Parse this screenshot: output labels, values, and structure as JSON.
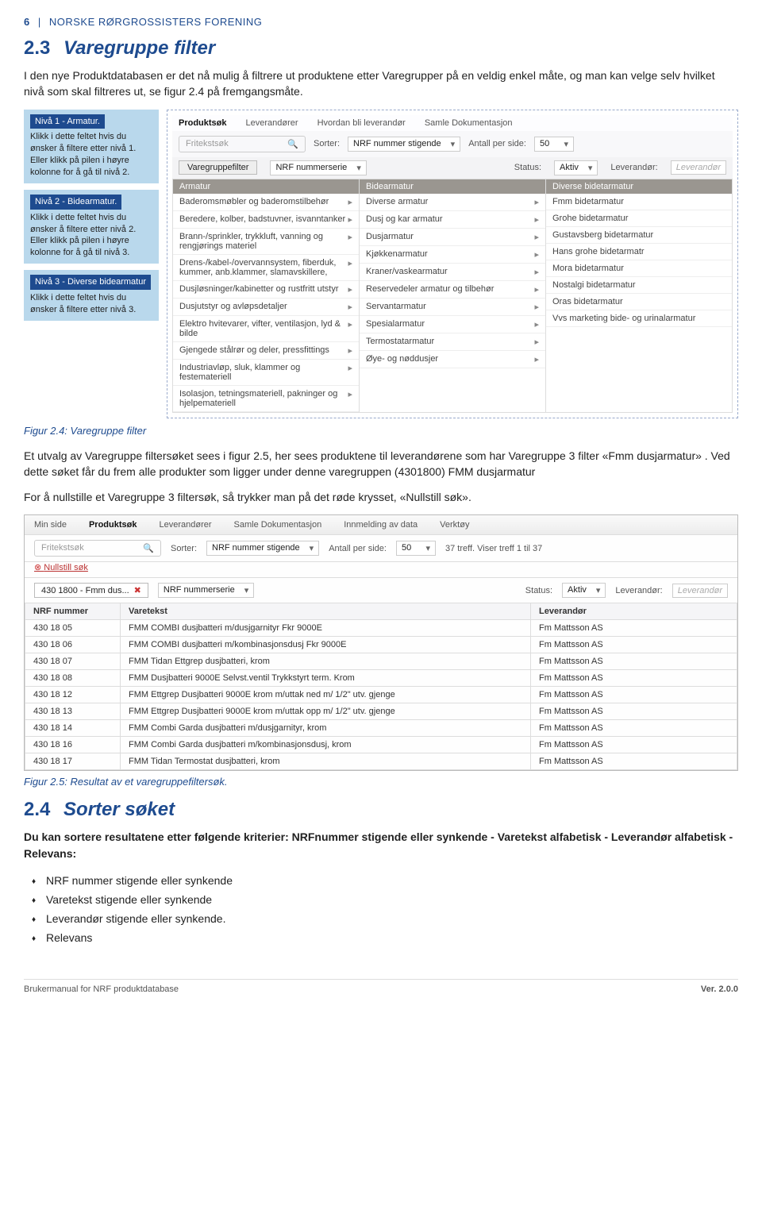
{
  "header": {
    "page": "6",
    "org": "NORSKE RØRGROSSISTERS FORENING"
  },
  "sec23": {
    "num": "2.3",
    "title": "Varegruppe filter",
    "intro": "I den nye Produktdatabasen er det nå mulig å filtrere ut produktene etter Varegrupper på en veldig enkel måte, og man kan velge selv hvilket nivå som skal filtreres ut, se figur 2.4 på fremgangsmåte."
  },
  "notes": [
    {
      "title": "Nivå 1 - Armatur.",
      "text": "Klikk i dette feltet hvis du ønsker å filtere etter nivå 1. Eller klikk på pilen i høyre kolonne for å gå til nivå 2."
    },
    {
      "title": "Nivå 2 - Bidearmatur.",
      "text": "Klikk i dette feltet hvis du ønsker å filtere etter nivå 2. Eller klikk på pilen i høyre kolonne for å gå til nivå 3."
    },
    {
      "title": "Nivå 3 - Diverse bidearmatur",
      "text": "Klikk i dette feltet hvis du ønsker å filtere etter nivå 3."
    }
  ],
  "app1": {
    "nav": [
      "Produktsøk",
      "Leverandører",
      "Hvordan bli leverandør",
      "Samle Dokumentasjon"
    ],
    "search_ph": "Fritekstsøk",
    "sort_lbl": "Sorter:",
    "sort_val": "NRF nummer stigende",
    "perpage_lbl": "Antall per side:",
    "perpage_val": "50",
    "vg_btn": "Varegruppefilter",
    "serie_lbl": "NRF nummerserie",
    "status_lbl": "Status:",
    "status_val": "Aktiv",
    "lev_lbl": "Leverandør:",
    "lev_ph": "Leverandør",
    "col1_hdr": "Armatur",
    "col2_hdr": "Bidearmatur",
    "col3_hdr": "Diverse bidetarmatur",
    "col1": [
      "Baderomsmøbler og baderomstilbehør",
      "Beredere, kolber, badstuvner, isvanntanker",
      "Brann-/sprinkler, trykkluft, vanning og rengjørings materiel",
      "Drens-/kabel-/overvannsystem, fiberduk, kummer, anb.klammer, slamavskillere,",
      "Dusjløsninger/kabinetter og rustfritt utstyr",
      "Dusjutstyr og avløpsdetaljer",
      "Elektro hvitevarer, vifter, ventilasjon, lyd & bilde",
      "Gjengede stålrør og deler, pressfittings",
      "Industriavløp, sluk, klammer og festemateriell",
      "Isolasjon, tetningsmateriell, pakninger og hjelpemateriell"
    ],
    "col2": [
      "Diverse armatur",
      "Dusj og kar armatur",
      "Dusjarmatur",
      "Kjøkkenarmatur",
      "Kraner/vaskearmatur",
      "Reservedeler armatur og tilbehør",
      "Servantarmatur",
      "Spesialarmatur",
      "Termostatarmatur",
      "Øye- og nøddusjer"
    ],
    "col3": [
      "Fmm bidetarmatur",
      "Grohe bidetarmatur",
      "Gustavsberg bidetarmatur",
      "Hans grohe bidetarmatr",
      "Mora bidetarmatur",
      "Nostalgi bidetarmatur",
      "Oras bidetarmatur",
      "Vvs marketing bide- og urinalarmatur"
    ]
  },
  "caption24": "Figur 2.4: Varegruppe filter",
  "mid1": "Et utvalg av Varegruppe filtersøket sees i figur 2.5, her sees produktene til leverandørene som har Varegruppe 3 filter «Fmm dusjarmatur» . Ved dette søket får du frem alle produkter som ligger under denne varegruppen (4301800) FMM dusjarmatur",
  "mid2": "For å nullstille et Varegruppe 3 filtersøk, så trykker man på det røde krysset, «Nullstill søk».",
  "app2": {
    "nav": [
      "Min side",
      "Produktsøk",
      "Leverandører",
      "Samle Dokumentasjon",
      "Innmelding av data",
      "Verktøy"
    ],
    "search_ph": "Fritekstsøk",
    "sort_lbl": "Sorter:",
    "sort_val": "NRF nummer stigende",
    "perpage_lbl": "Antall per side:",
    "perpage_val": "50",
    "count_txt": "37 treff. Viser treff 1 til 37",
    "reset": "Nullstill søk",
    "chip": "430 1800 - Fmm dus...",
    "serie_lbl": "NRF nummerserie",
    "status_lbl": "Status:",
    "status_val": "Aktiv",
    "lev_lbl": "Leverandør:",
    "lev_ph": "Leverandør",
    "th": [
      "NRF nummer",
      "Varetekst",
      "Leverandør"
    ],
    "rows": [
      [
        "430 18 05",
        "FMM COMBI dusjbatteri m/dusjgarnityr Fkr 9000E",
        "Fm Mattsson AS"
      ],
      [
        "430 18 06",
        "FMM COMBI dusjbatteri m/kombinasjonsdusj Fkr 9000E",
        "Fm Mattsson AS"
      ],
      [
        "430 18 07",
        "FMM Tidan Ettgrep dusjbatteri, krom",
        "Fm Mattsson AS"
      ],
      [
        "430 18 08",
        "FMM Dusjbatteri 9000E Selvst.ventil Trykkstyrt term. Krom",
        "Fm Mattsson AS"
      ],
      [
        "430 18 12",
        "FMM Ettgrep Dusjbatteri 9000E krom m/uttak ned m/ 1/2\" utv. gjenge",
        "Fm Mattsson AS"
      ],
      [
        "430 18 13",
        "FMM Ettgrep Dusjbatteri 9000E krom m/uttak opp m/ 1/2\" utv. gjenge",
        "Fm Mattsson AS"
      ],
      [
        "430 18 14",
        "FMM Combi Garda dusjbatteri m/dusjgarnityr, krom",
        "Fm Mattsson AS"
      ],
      [
        "430 18 16",
        "FMM Combi Garda dusjbatteri m/kombinasjonsdusj, krom",
        "Fm Mattsson AS"
      ],
      [
        "430 18 17",
        "FMM Tidan Termostat dusjbatteri, krom",
        "Fm Mattsson AS"
      ]
    ]
  },
  "caption25": "Figur 2.5: Resultat av et varegruppefiltersøk.",
  "sec24": {
    "num": "2.4",
    "title": "Sorter søket",
    "intro": "Du kan sortere resultatene etter følgende kriterier: NRFnummer stigende eller synkende - Varetekst alfabetisk - Leverandør alfabetisk - Relevans:",
    "bullets": [
      "NRF nummer stigende eller synkende",
      "Varetekst stigende eller synkende",
      "Leverandør stigende eller synkende.",
      "Relevans"
    ]
  },
  "footer": {
    "left": "Brukermanual for NRF produktdatabase",
    "right": "Ver. 2.0.0"
  }
}
